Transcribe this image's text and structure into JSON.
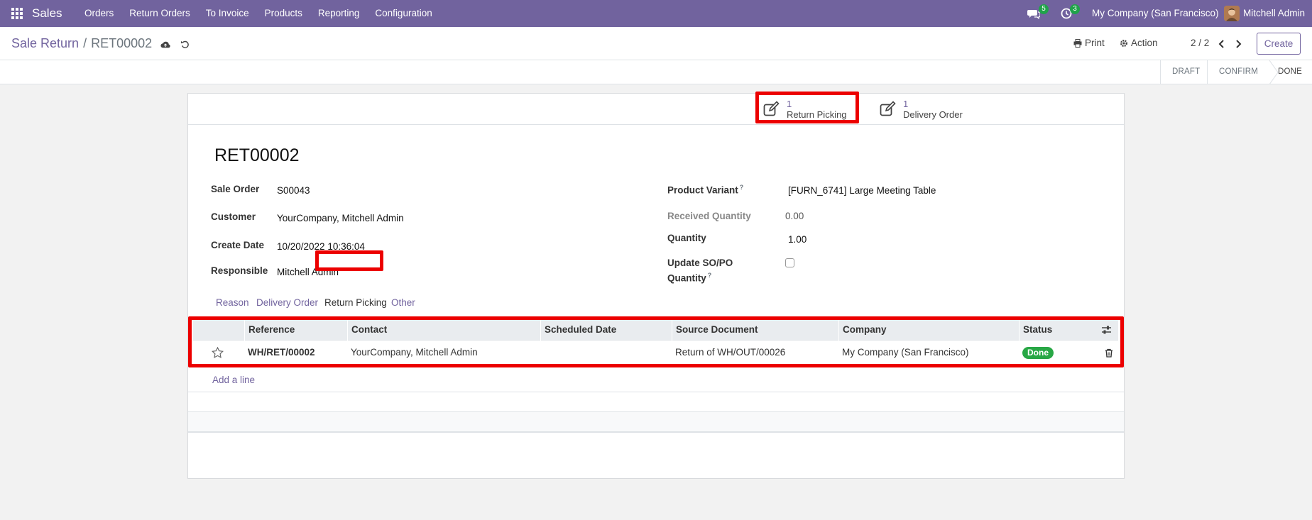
{
  "navbar": {
    "app_name": "Sales",
    "menu": [
      "Orders",
      "Return Orders",
      "To Invoice",
      "Products",
      "Reporting",
      "Configuration"
    ],
    "messages_badge": "5",
    "activities_badge": "3",
    "company": "My Company (San Francisco)",
    "user": "Mitchell Admin"
  },
  "control_panel": {
    "breadcrumb_parent": "Sale Return",
    "breadcrumb_separator": "/",
    "breadcrumb_current": "RET00002",
    "print_label": "Print",
    "action_label": "Action",
    "pager": "2 / 2",
    "create_label": "Create"
  },
  "statusbar": {
    "stages": [
      "DRAFT",
      "CONFIRM",
      "DONE"
    ],
    "active_stage": "DONE"
  },
  "smart_buttons": [
    {
      "count": "1",
      "label": "Return Picking",
      "highlighted": true
    },
    {
      "count": "1",
      "label": "Delivery Order",
      "highlighted": false
    }
  ],
  "record": {
    "name": "RET00002",
    "left_fields": [
      {
        "label": "Sale Order",
        "value": "S00043"
      },
      {
        "label": "Customer",
        "value": "YourCompany, Mitchell Admin"
      },
      {
        "label": "Create Date",
        "value": "10/20/2022 10:36:04"
      },
      {
        "label": "Responsible",
        "value": "Mitchell Admin"
      }
    ],
    "product_variant_label": "Product Variant",
    "product_variant_value": "[FURN_6741] Large Meeting Table",
    "received_qty_label": "Received Quantity",
    "received_qty_value": "0.00",
    "quantity_label": "Quantity",
    "quantity_value": "1.00",
    "update_so_label_1": "Update SO/PO",
    "update_so_label_2": "Quantity",
    "update_so_checked": false,
    "help_mark": "?"
  },
  "tabs": [
    "Reason",
    "Delivery Order",
    "Return Picking",
    "Other"
  ],
  "active_tab": "Return Picking",
  "list": {
    "columns": [
      "Reference",
      "Contact",
      "Scheduled Date",
      "Source Document",
      "Company",
      "Status"
    ],
    "rows": [
      {
        "reference": "WH/RET/00002",
        "contact": "YourCompany, Mitchell Admin",
        "scheduled_date": "",
        "source_document": "Return of WH/OUT/00026",
        "company": "My Company (San Francisco)",
        "status": "Done"
      }
    ],
    "add_line_label": "Add a line"
  },
  "colors": {
    "brand": "#71639e",
    "highlight": "#ec0000",
    "status_done": "#28a745"
  }
}
